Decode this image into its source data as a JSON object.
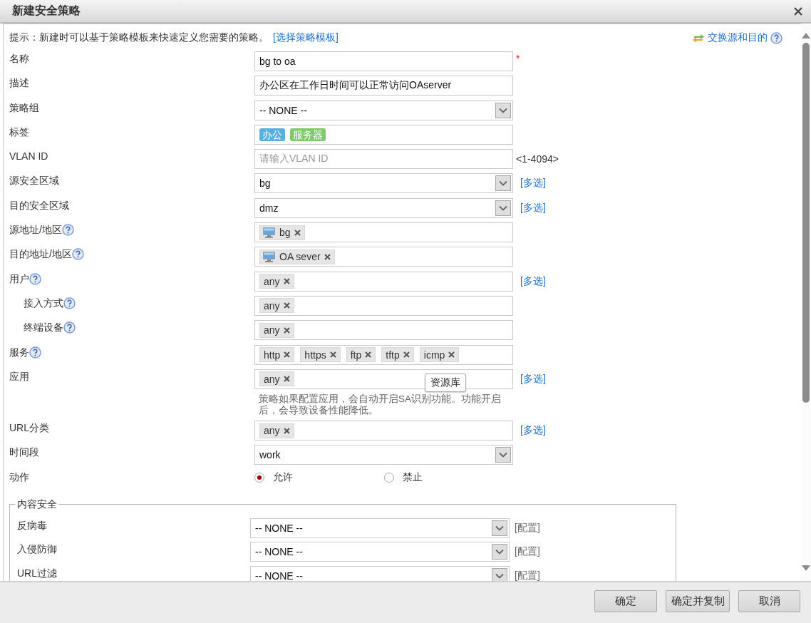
{
  "window": {
    "title": "新建安全策略"
  },
  "hint": {
    "text": "提示：新建时可以基于策略模板来快速定义您需要的策略。",
    "link": "[选择策略模板]"
  },
  "swap_link": "交换源和目的",
  "fields": [
    {
      "label": "名称",
      "kind": "text",
      "value": "bg to oa",
      "marker": "*",
      "help": false
    },
    {
      "label": "描述",
      "kind": "text",
      "value": "办公区在工作日时间可以正常访问OAserver",
      "help": false
    },
    {
      "label": "策略组",
      "kind": "select",
      "value": "-- NONE --",
      "help": false
    },
    {
      "label": "标签",
      "kind": "tags",
      "help": false,
      "tags": [
        {
          "text": "办公",
          "color": "#5aaee0"
        },
        {
          "text": "服务器",
          "color": "#7dcb6a"
        }
      ]
    },
    {
      "label": "VLAN ID",
      "kind": "text",
      "placeholder": "请输入VLAN ID",
      "range_hint": "<1-4094>",
      "help": false
    },
    {
      "label": "源安全区域",
      "kind": "select",
      "value": "bg",
      "link": "[多选]",
      "help": false
    },
    {
      "label": "目的安全区域",
      "kind": "select",
      "value": "dmz",
      "link": "[多选]",
      "help": false
    },
    {
      "label": "源地址/地区",
      "kind": "chips",
      "help": true,
      "chips": [
        {
          "text": "bg",
          "kind": "host"
        }
      ]
    },
    {
      "label": "目的地址/地区",
      "kind": "chips",
      "help": true,
      "chips": [
        {
          "text": "OA sever",
          "kind": "host"
        }
      ]
    },
    {
      "label": "用户",
      "kind": "chips",
      "help": true,
      "chips": [
        {
          "text": "any",
          "kind": "plain"
        }
      ],
      "link": "[多选]",
      "children": [
        {
          "label": "接入方式",
          "kind": "chips",
          "help": true,
          "chips": [
            {
              "text": "any",
              "kind": "plain"
            }
          ]
        },
        {
          "label": "终端设备",
          "kind": "chips",
          "help": true,
          "chips": [
            {
              "text": "any",
              "kind": "plain"
            }
          ]
        }
      ]
    },
    {
      "label": "服务",
      "kind": "chips",
      "help": true,
      "chips": [
        {
          "text": "http",
          "kind": "plain"
        },
        {
          "text": "https",
          "kind": "plain"
        },
        {
          "text": "ftp",
          "kind": "plain"
        },
        {
          "text": "tftp",
          "kind": "plain"
        },
        {
          "text": "icmp",
          "kind": "plain"
        }
      ]
    },
    {
      "label": "应用",
      "kind": "chips",
      "help": false,
      "chips": [
        {
          "text": "any",
          "kind": "plain"
        }
      ],
      "link": "[多选]",
      "tooltip": "资源库",
      "note": "策略如果配置应用，会自动开启SA识别功能。功能开启后，会导致设备性能降低。"
    },
    {
      "label": "URL分类",
      "kind": "chips",
      "help": false,
      "chips": [
        {
          "text": "any",
          "kind": "plain"
        }
      ],
      "link": "[多选]"
    },
    {
      "label": "时间段",
      "kind": "select",
      "value": "work",
      "help": false
    },
    {
      "label": "动作",
      "kind": "radio",
      "help": false,
      "options": [
        {
          "label": "允许",
          "selected": true
        },
        {
          "label": "禁止",
          "selected": false
        }
      ]
    }
  ],
  "content_security": {
    "title": "内容安全",
    "rows": [
      {
        "label": "反病毒",
        "value": "-- NONE --",
        "link": "[配置]"
      },
      {
        "label": "入侵防御",
        "value": "-- NONE --",
        "link": "[配置]"
      },
      {
        "label": "URL过滤",
        "value": "-- NONE --",
        "link": "[配置]"
      }
    ]
  },
  "buttons": [
    "确定",
    "确定并复制",
    "取消"
  ]
}
